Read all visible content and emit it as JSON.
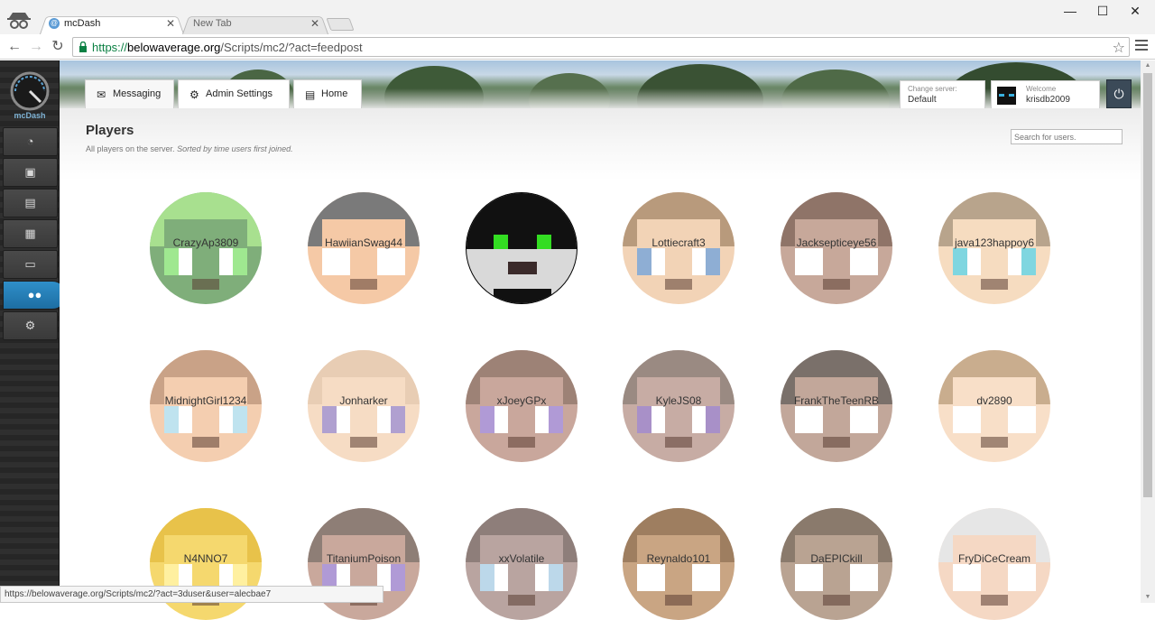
{
  "browser": {
    "tabs": [
      {
        "label": "mcDash",
        "active": true
      },
      {
        "label": "New Tab",
        "active": false
      }
    ],
    "url": {
      "scheme": "https://",
      "host": "belowaverage.org",
      "path": "/Scripts/mc2/?act=feedpost"
    },
    "window_controls": [
      "—",
      "☐",
      "✕"
    ],
    "status_url": "https://belowaverage.org/Scripts/mc2/?act=3duser&user=alecbae7"
  },
  "app": {
    "logo_text": "mcDash",
    "sidebar_icons": [
      "dashboard-icon",
      "image-icon",
      "document-icon",
      "grid-icon",
      "chat-icon",
      "users-icon",
      "gear-icon"
    ],
    "active_sidebar_index": 5,
    "top_tabs": [
      {
        "label": "Messaging",
        "icon": "envelope-icon"
      },
      {
        "label": "Admin Settings",
        "icon": "gear-icon"
      },
      {
        "label": "Home",
        "icon": "document-icon"
      }
    ],
    "server": {
      "caption": "Change server:",
      "value": "Default"
    },
    "welcome": {
      "caption": "Welcome",
      "user": "krisdb2009"
    },
    "accent": "#1d6ea3"
  },
  "page": {
    "title": "Players",
    "subtitle": "All players on the server.",
    "subtitle_note": "Sorted by time users first joined.",
    "search_placeholder": "Search for users."
  },
  "players": [
    {
      "name": "CrazyAp3809",
      "skin": "#7fae7a",
      "accent": "#a8e08f",
      "eyes": "#9fe890"
    },
    {
      "name": "HawiianSwag44",
      "skin": "#f5c9a6",
      "accent": "#7a7a7a",
      "eyes": "#ffffff"
    },
    {
      "name": "",
      "skin": "#d9d9d9",
      "accent": "#111111",
      "eyes": "#33dd22"
    },
    {
      "name": "Lottiecraft3",
      "skin": "#f2d3b6",
      "accent": "#b89a7c",
      "eyes": "#8eaed4"
    },
    {
      "name": "Jacksepticeye56",
      "skin": "#c7a89a",
      "accent": "#8f7468",
      "eyes": "#ffffff"
    },
    {
      "name": "java123happoy6",
      "skin": "#f6dcc0",
      "accent": "#b8a48c",
      "eyes": "#7fd6e0"
    },
    {
      "name": "MidnightGirl1234",
      "skin": "#f4ceb0",
      "accent": "#c9a287",
      "eyes": "#bfe3ef"
    },
    {
      "name": "Jonharker",
      "skin": "#f6dcc4",
      "accent": "#e8cdb4",
      "eyes": "#b0a0d0"
    },
    {
      "name": "xJoeyGPx",
      "skin": "#c9a79c",
      "accent": "#9d8276",
      "eyes": "#b09ad6"
    },
    {
      "name": "KyleJS08",
      "skin": "#c7aca4",
      "accent": "#9a8a82",
      "eyes": "#a890c8"
    },
    {
      "name": "FrankTheTeenRB",
      "skin": "#c2a79a",
      "accent": "#7a706a",
      "eyes": "#ffffff"
    },
    {
      "name": "dv2890",
      "skin": "#f8dfc8",
      "accent": "#c9ad8e",
      "eyes": "#ffffff"
    },
    {
      "name": "N4NNO7",
      "skin": "#f5d86e",
      "accent": "#e8c24a",
      "eyes": "#fff0a0"
    },
    {
      "name": "TitaniumPoison",
      "skin": "#c9a89c",
      "accent": "#8e7e76",
      "eyes": "#b09ad6"
    },
    {
      "name": "xxVolatile",
      "skin": "#b9a4a0",
      "accent": "#8e7e7a",
      "eyes": "#bcd8ea"
    },
    {
      "name": "Reynaldo101",
      "skin": "#c9a583",
      "accent": "#9e7e60",
      "eyes": "#ffffff"
    },
    {
      "name": "DaEPICkill",
      "skin": "#b9a392",
      "accent": "#8a7a6c",
      "eyes": "#ffffff"
    },
    {
      "name": "FryDiCeCream",
      "skin": "#f5d8c4",
      "accent": "#e6e6e6",
      "eyes": "#ffffff"
    }
  ]
}
